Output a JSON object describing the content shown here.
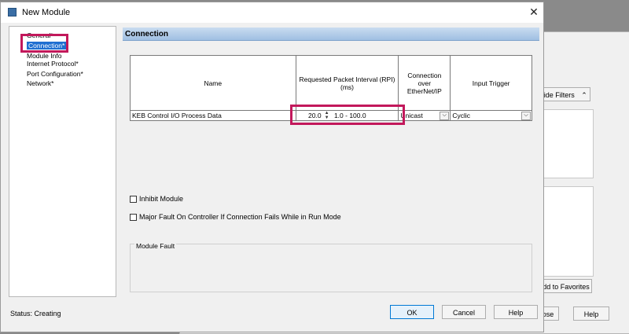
{
  "background_window": {
    "hide_filters_label": "Hide Filters",
    "hide_filters_icon": "double-chevron-up",
    "add_to_favorites_label": "Add to Favorites",
    "close_label": "lose",
    "help_label": "Help"
  },
  "dialog": {
    "title": "New Module",
    "close_glyph": "✕",
    "tree": {
      "items": [
        {
          "label": "General*"
        },
        {
          "label": "Connection*",
          "selected": true
        },
        {
          "label": "Module Info"
        },
        {
          "label": "Internet Protocol*"
        },
        {
          "label": "Port Configuration*"
        },
        {
          "label": "Network*"
        }
      ]
    },
    "section_title": "Connection",
    "table": {
      "headers": [
        "Name",
        "Requested Packet Interval (RPI) (ms)",
        "Connection over EtherNet/IP",
        "Input Trigger"
      ],
      "row": {
        "name": "KEB Control I/O Process Data",
        "rpi_value": "20.0",
        "rpi_range": "1.0 - 100.0",
        "connection": "Unicast",
        "input_trigger": "Cyclic"
      }
    },
    "checkboxes": {
      "inhibit_module": "Inhibit Module",
      "major_fault": "Major Fault On Controller If Connection Fails While in Run Mode"
    },
    "module_fault_label": "Module Fault",
    "status_text": "Status:  Creating",
    "buttons": {
      "ok": "OK",
      "cancel": "Cancel",
      "help": "Help"
    }
  },
  "colors": {
    "highlight": "#c2185b",
    "selection": "#1f6fd1",
    "header": "#9fbfe2"
  }
}
